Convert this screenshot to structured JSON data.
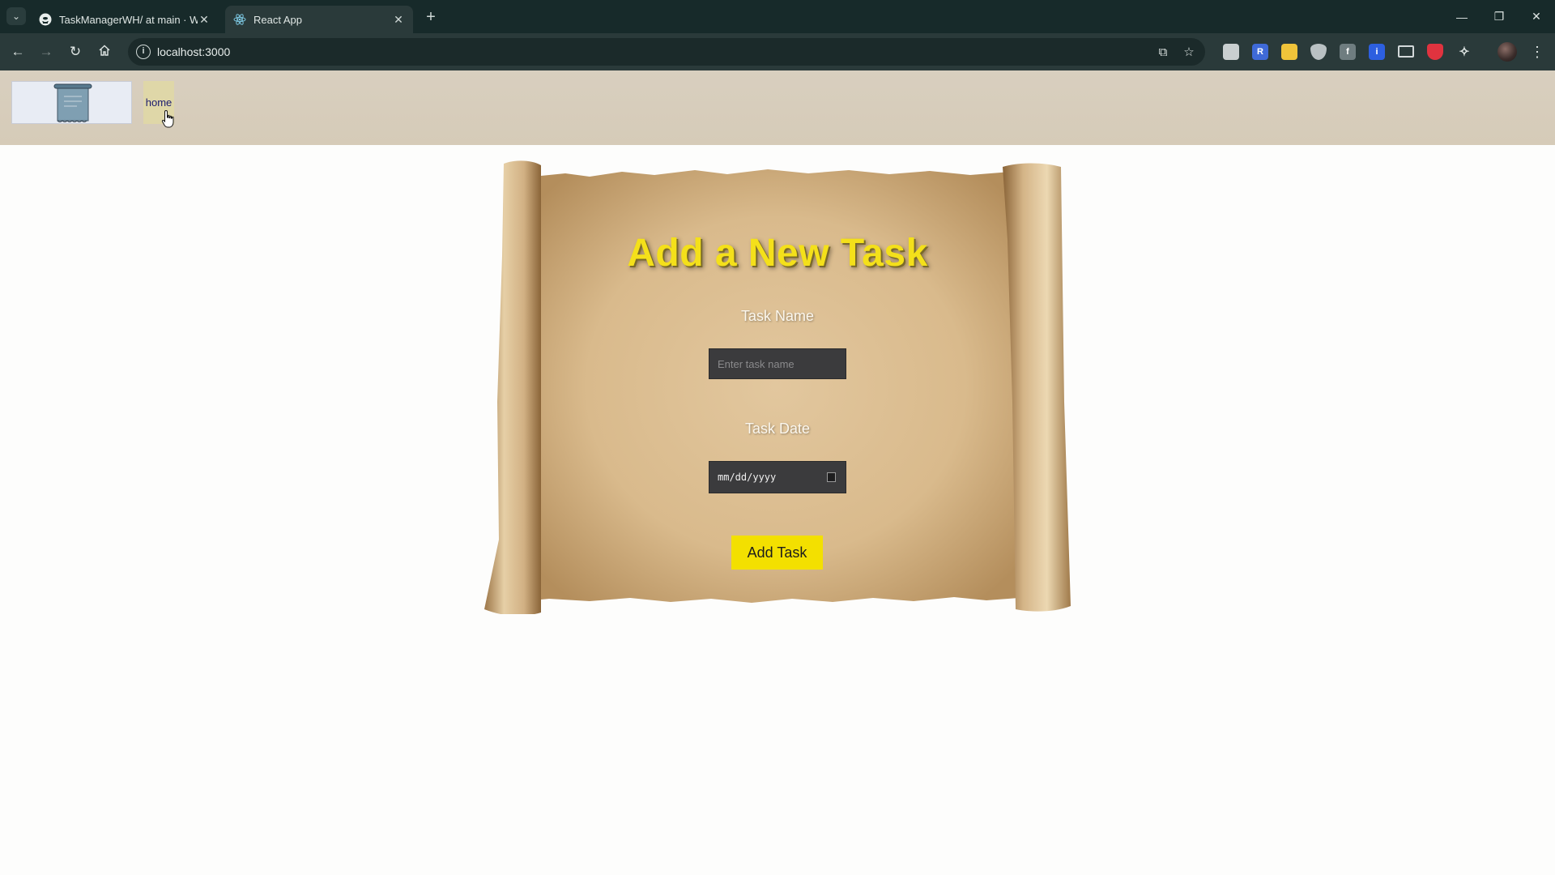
{
  "browser": {
    "tabs": [
      {
        "title": "TaskManagerWH/ at main · Wa",
        "favicon": "github-icon",
        "active": false
      },
      {
        "title": "React App",
        "favicon": "react-icon",
        "active": true
      }
    ],
    "url": "localhost:3000",
    "extensions": [
      {
        "name": "extension-cube-icon",
        "color": "#c9cfd0"
      },
      {
        "name": "extension-r-icon",
        "color": "#3f6ad8",
        "text": "R"
      },
      {
        "name": "extension-cloud-icon",
        "color": "#f0c43a"
      },
      {
        "name": "extension-shield-icon",
        "color": "#b9c1c3"
      },
      {
        "name": "extension-f-icon",
        "color": "#6f7d80",
        "text": "f"
      },
      {
        "name": "extension-i-icon",
        "color": "#2d5fe0",
        "text": "i"
      },
      {
        "name": "extension-monitor-icon",
        "color": "#d3d9da"
      },
      {
        "name": "extension-pocket-icon",
        "color": "#e0333f"
      }
    ]
  },
  "header": {
    "nav_home": "home"
  },
  "form": {
    "title": "Add a New Task",
    "task_name_label": "Task Name",
    "task_name_placeholder": "Enter task name",
    "task_date_label": "Task Date",
    "task_date_value": "mm/dd/yyyy",
    "submit_label": "Add Task"
  },
  "colors": {
    "title": "#f4e01a",
    "button": "#f3e000",
    "input_bg": "#3b3b3d",
    "header_bg": "#d8cfbf"
  }
}
